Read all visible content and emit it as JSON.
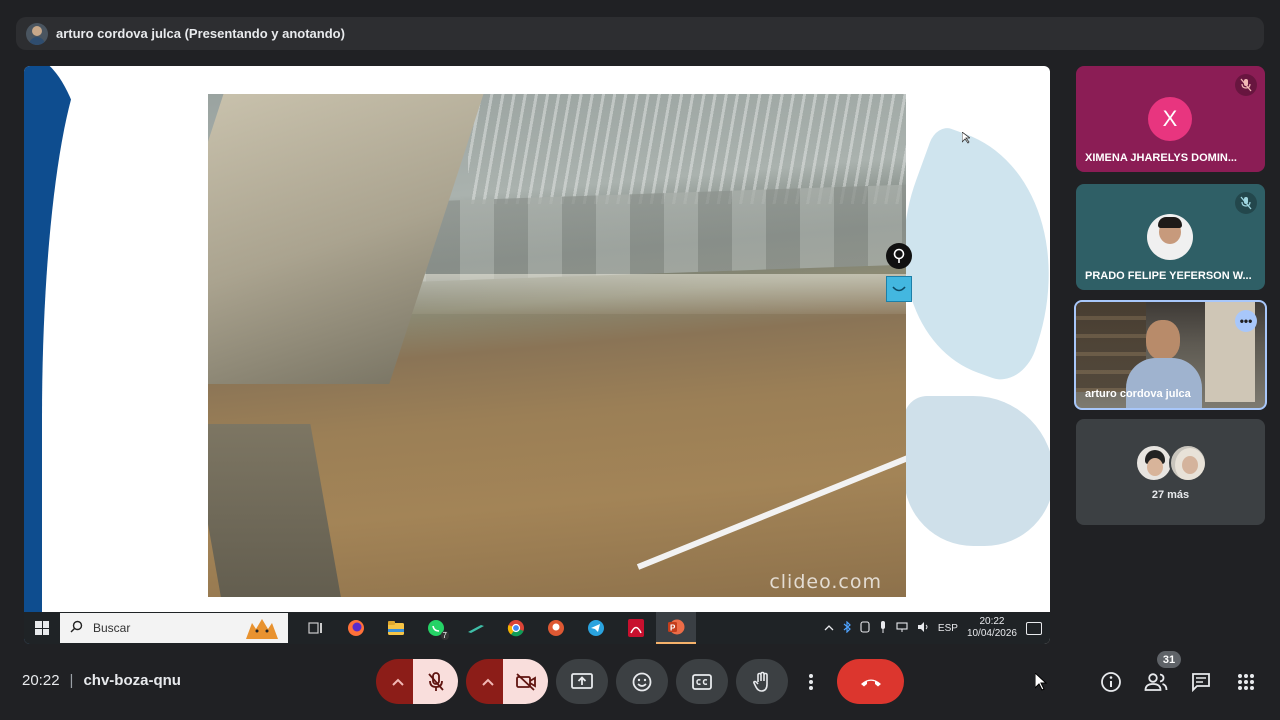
{
  "header": {
    "presenter_status": "arturo cordova julca (Presentando y anotando)"
  },
  "shared_screen": {
    "watermark": "clideo.com",
    "taskbar": {
      "search_label": "Buscar",
      "apps": [
        {
          "icon": "task-view-icon"
        },
        {
          "icon": "firefox-icon"
        },
        {
          "icon": "file-explorer-icon"
        },
        {
          "icon": "whatsapp-icon",
          "badge": "7"
        },
        {
          "icon": "pen-tool-icon"
        },
        {
          "icon": "chrome-icon"
        },
        {
          "icon": "duckduckgo-icon"
        },
        {
          "icon": "telegram-icon"
        },
        {
          "icon": "acrobat-icon"
        },
        {
          "icon": "powerpoint-icon",
          "active": true
        }
      ],
      "language": "ESP",
      "time": "20:22",
      "date": "10/04/2026"
    }
  },
  "participants": [
    {
      "name": "XIMENA JHARELYS DOMIN...",
      "initial": "X",
      "muted": true
    },
    {
      "name": "PRADO FELIPE YEFERSON W...",
      "muted": true
    },
    {
      "name": "arturo cordova julca",
      "presenting": true
    },
    {
      "more_label": "27 más"
    }
  ],
  "meeting": {
    "time": "20:22",
    "separator": "|",
    "code": "chv-boza-qnu",
    "participant_count": "31"
  },
  "colors": {
    "background": "#202124",
    "end_call": "#dc362e",
    "muted_red": "#8c1d18",
    "muted_pink": "#f9dedc",
    "active_border": "#a8c7fa",
    "tile_ximena": "#8b1d55",
    "tile_prado": "#2f5f66"
  }
}
